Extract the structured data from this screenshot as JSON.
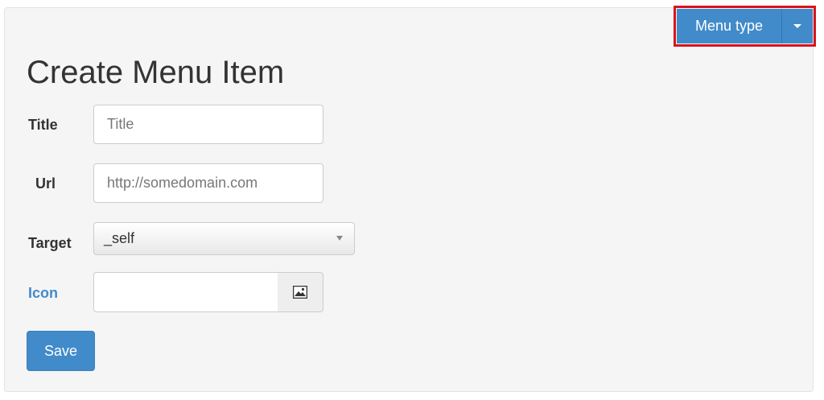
{
  "header": {
    "title": "Create Menu Item",
    "menu_type_label": "Menu type"
  },
  "form": {
    "title_label": "Title",
    "title_placeholder": "Title",
    "url_label": "Url",
    "url_placeholder": "http://somedomain.com",
    "target_label": "Target",
    "target_value": "_self",
    "icon_label": "Icon",
    "icon_value": "",
    "save_label": "Save"
  },
  "colors": {
    "primary": "#428bca",
    "highlight": "#d9141c",
    "panel_bg": "#f5f5f5"
  },
  "icons": {
    "menu_type_caret": "caret-down-icon",
    "icon_picker": "image-icon",
    "select_arrow": "chevron-down-icon"
  }
}
